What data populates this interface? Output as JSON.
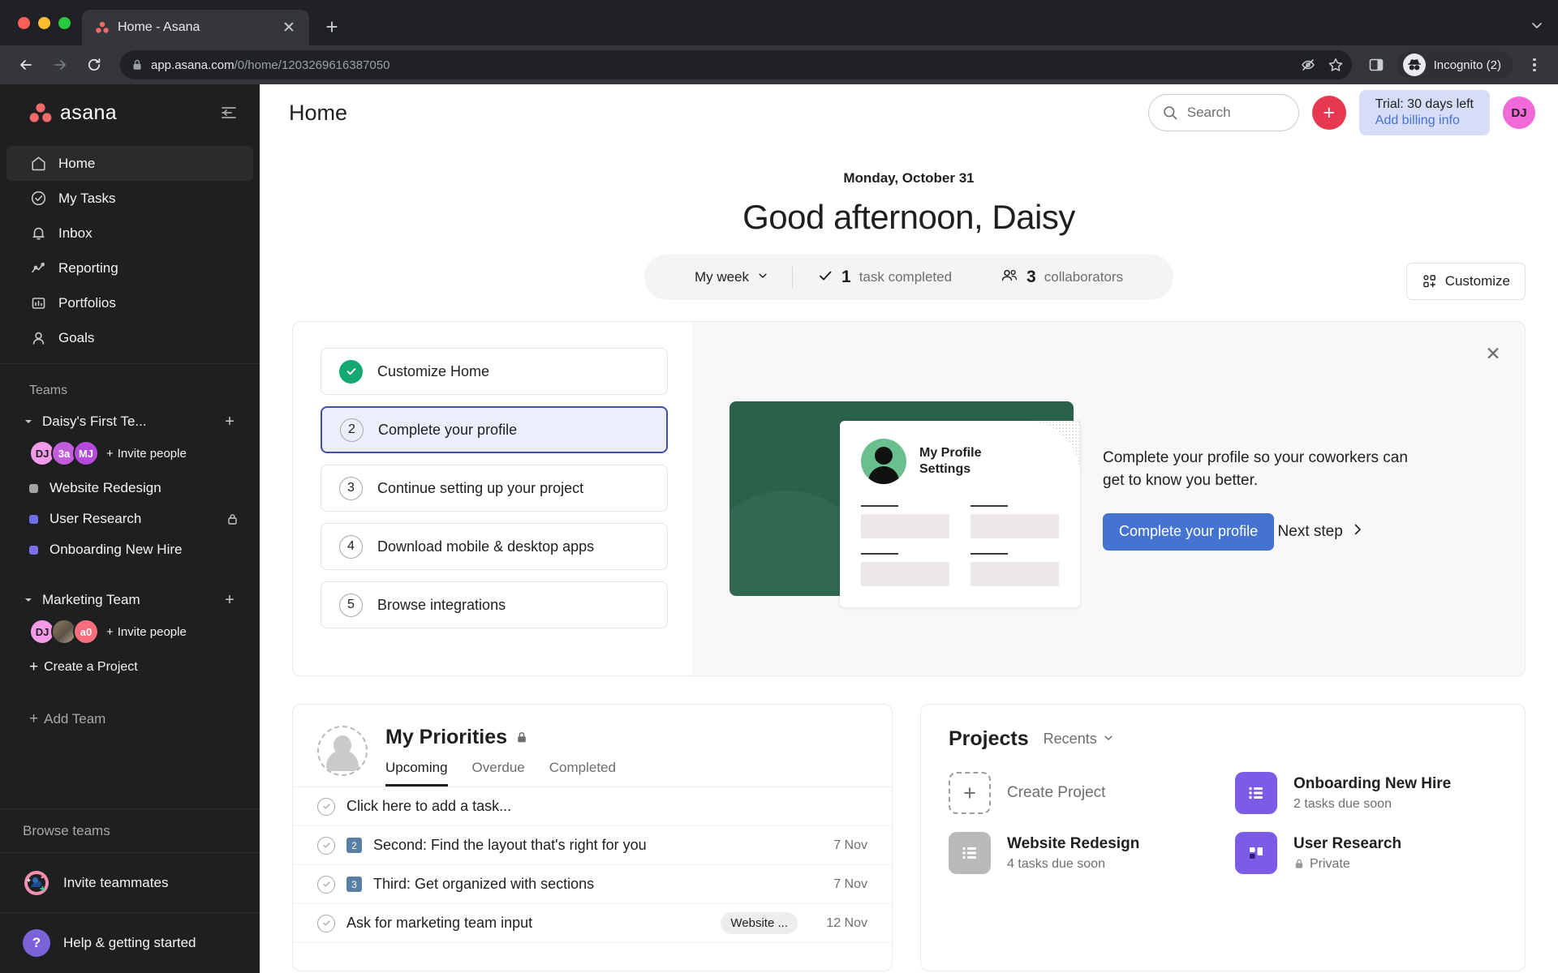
{
  "browser": {
    "tab_title": "Home - Asana",
    "tab_favicon_icon": "asana-logo-icon",
    "new_tab_icon": "plus-icon",
    "tabstrip_menu_icon": "chevron-down-icon",
    "back_icon": "arrow-left-icon",
    "forward_icon": "arrow-right-icon",
    "reload_icon": "reload-icon",
    "lock_icon": "lock-icon",
    "url_domain": "app.asana.com",
    "url_path": "/0/home/1203269616387050",
    "tracking_icon": "eye-slash-icon",
    "bookmark_icon": "star-icon",
    "sidepanel_icon": "side-panel-icon",
    "incognito_label": "Incognito (2)",
    "incognito_icon": "incognito-icon",
    "menu_icon": "kebab-menu-icon"
  },
  "sidebar": {
    "brand": "asana",
    "collapse_icon": "collapse-sidebar-icon",
    "nav": [
      {
        "label": "Home",
        "icon": "home-icon",
        "active": true
      },
      {
        "label": "My Tasks",
        "icon": "check-circle-icon",
        "active": false
      },
      {
        "label": "Inbox",
        "icon": "bell-icon",
        "active": false
      },
      {
        "label": "Reporting",
        "icon": "chart-line-icon",
        "active": false
      },
      {
        "label": "Portfolios",
        "icon": "portfolio-icon",
        "active": false
      },
      {
        "label": "Goals",
        "icon": "goal-icon",
        "active": false
      }
    ],
    "teams_label": "Teams",
    "teams": [
      {
        "name": "Daisy's First Te...",
        "add_icon": "plus-icon",
        "caret_icon": "caret-down-icon",
        "members": [
          {
            "initials": "DJ",
            "color": "#f39ae8"
          },
          {
            "initials": "3a",
            "color": "#c35ddb"
          },
          {
            "initials": "MJ",
            "color": "#b54adb"
          }
        ],
        "invite_label": "Invite people",
        "projects": [
          {
            "name": "Website Redesign",
            "color": "#a4a4a4",
            "private": false
          },
          {
            "name": "User Research",
            "color": "#6e6ee6",
            "private": true
          },
          {
            "name": "Onboarding New Hire",
            "color": "#7c6fe8",
            "private": false
          }
        ]
      },
      {
        "name": "Marketing Team",
        "add_icon": "plus-icon",
        "caret_icon": "caret-down-icon",
        "members": [
          {
            "initials": "DJ",
            "color": "#f39ae8"
          },
          {
            "initials": "",
            "color": "#8a7a60"
          },
          {
            "initials": "a0",
            "color": "#f96e7d"
          }
        ],
        "invite_label": "Invite people",
        "projects": [],
        "create_project_label": "Create a Project"
      }
    ],
    "add_team_label": "Add Team",
    "browse_teams_label": "Browse teams",
    "invite_teammates_label": "Invite teammates",
    "invite_teammates_icon": "invite-teammates-icon",
    "help_label": "Help & getting started",
    "help_icon": "question-mark-icon"
  },
  "topbar": {
    "page_title": "Home",
    "search_placeholder": "Search",
    "search_icon": "search-icon",
    "quick_add_icon": "plus-icon",
    "trial_title": "Trial: 30 days left",
    "trial_link": "Add billing info",
    "user_initials": "DJ",
    "user_avatar_color": "#f06bd8"
  },
  "home": {
    "date": "Monday, October 31",
    "greeting": "Good afternoon, Daisy",
    "range_label": "My week",
    "range_caret_icon": "chevron-down-icon",
    "stats": [
      {
        "icon": "check-icon",
        "num": "1",
        "label": "task completed"
      },
      {
        "icon": "collaborators-icon",
        "num": "3",
        "label": "collaborators"
      }
    ],
    "customize_label": "Customize",
    "customize_icon": "customize-grid-icon"
  },
  "onboarding": {
    "close_icon": "close-icon",
    "steps": [
      {
        "num": "1",
        "label": "Customize Home",
        "state": "done"
      },
      {
        "num": "2",
        "label": "Complete your profile",
        "state": "active"
      },
      {
        "num": "3",
        "label": "Continue setting up your project",
        "state": "todo"
      },
      {
        "num": "4",
        "label": "Download mobile & desktop apps",
        "state": "todo"
      },
      {
        "num": "5",
        "label": "Browse integrations",
        "state": "todo"
      }
    ],
    "illustration": {
      "title_line1": "My Profile",
      "title_line2": "Settings",
      "avatar_icon": "person-avatar-icon"
    },
    "description": "Complete your profile so your coworkers can get to know you better.",
    "cta_label": "Complete your profile",
    "next_step_label": "Next step",
    "next_step_icon": "chevron-right-icon"
  },
  "priorities": {
    "title": "My Priorities",
    "lock_icon": "lock-icon",
    "avatar_icon": "user-placeholder-icon",
    "tabs": [
      {
        "label": "Upcoming",
        "active": true
      },
      {
        "label": "Overdue",
        "active": false
      },
      {
        "label": "Completed",
        "active": false
      }
    ],
    "add_task_placeholder": "Click here to add a task...",
    "tasks": [
      {
        "badge": "2",
        "name": "Second: Find the layout that's right for you",
        "project": "",
        "date": "7 Nov"
      },
      {
        "badge": "3",
        "name": "Third: Get organized with sections",
        "project": "",
        "date": "7 Nov"
      },
      {
        "badge": "",
        "name": "Ask for marketing team input",
        "project": "Website ...",
        "date": "12 Nov"
      }
    ]
  },
  "projects": {
    "title": "Projects",
    "filter_label": "Recents",
    "filter_icon": "chevron-down-icon",
    "create_label": "Create Project",
    "create_icon": "plus-icon",
    "items": [
      {
        "name": "Onboarding New Hire",
        "sub": "2 tasks due soon",
        "color": "#7c5ce6",
        "icon": "list-icon",
        "private": false
      },
      {
        "name": "Website Redesign",
        "sub": "4 tasks due soon",
        "color": "#b9b9b9",
        "icon": "list-icon",
        "private": false
      },
      {
        "name": "User Research",
        "sub": "Private",
        "color": "#7c5ce6",
        "icon": "board-icon",
        "private": true
      }
    ]
  }
}
